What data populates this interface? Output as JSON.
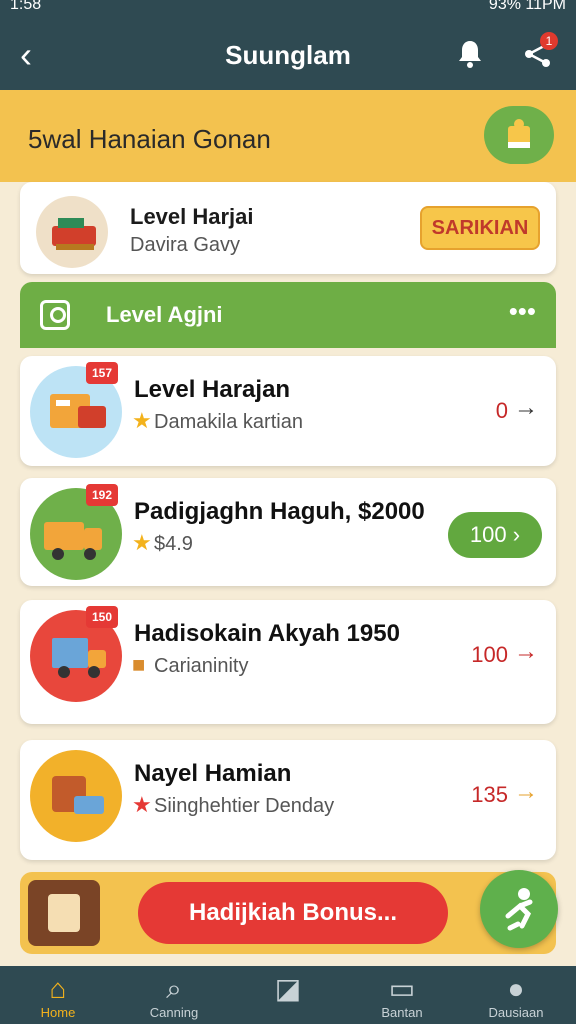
{
  "status_bar": {
    "time": "1:58",
    "right": "93% 11PM"
  },
  "header": {
    "title": "Suunglam"
  },
  "banner": {
    "title": "5wal Hanaian Gonan"
  },
  "card1": {
    "title": "Level Harjai",
    "subtitle": "Davira Gavy",
    "button": "SARIKIAN"
  },
  "section": {
    "title": "Level Agjni",
    "more": "•••"
  },
  "items": [
    {
      "badge": "157",
      "title": "Level Harajan",
      "subtitle": "Damakila kartian",
      "value": "0",
      "arrow": "→",
      "color": "#c62828"
    },
    {
      "badge": "192",
      "title": "Padigjaghn Haguh, $2000",
      "subtitle": "$4.9",
      "button": "100 ›"
    },
    {
      "badge": "150",
      "title": "Hadisokain Akyah 1950",
      "subtitle": "Carianinity",
      "value": "100",
      "arrow": "→",
      "color": "#c62828"
    },
    {
      "title": "Nayel Hamian",
      "subtitle": "Siinghehtier Denday",
      "value": "135",
      "arrow": "→",
      "color": "#c62828"
    }
  ],
  "bonus": {
    "label": "Hadijkiah Bonus..."
  },
  "nav": [
    {
      "label": "Home",
      "icon": "home-icon"
    },
    {
      "label": "Canning",
      "icon": "search-icon"
    },
    {
      "label": "",
      "icon": "note-icon"
    },
    {
      "label": "Bantan",
      "icon": "card-icon"
    },
    {
      "label": "Dausiaan",
      "icon": "profile-icon"
    }
  ],
  "colors": {
    "header": "#2f4a52",
    "banner": "#f3c24f",
    "accent_green": "#6eae45",
    "accent_red": "#e53935"
  }
}
